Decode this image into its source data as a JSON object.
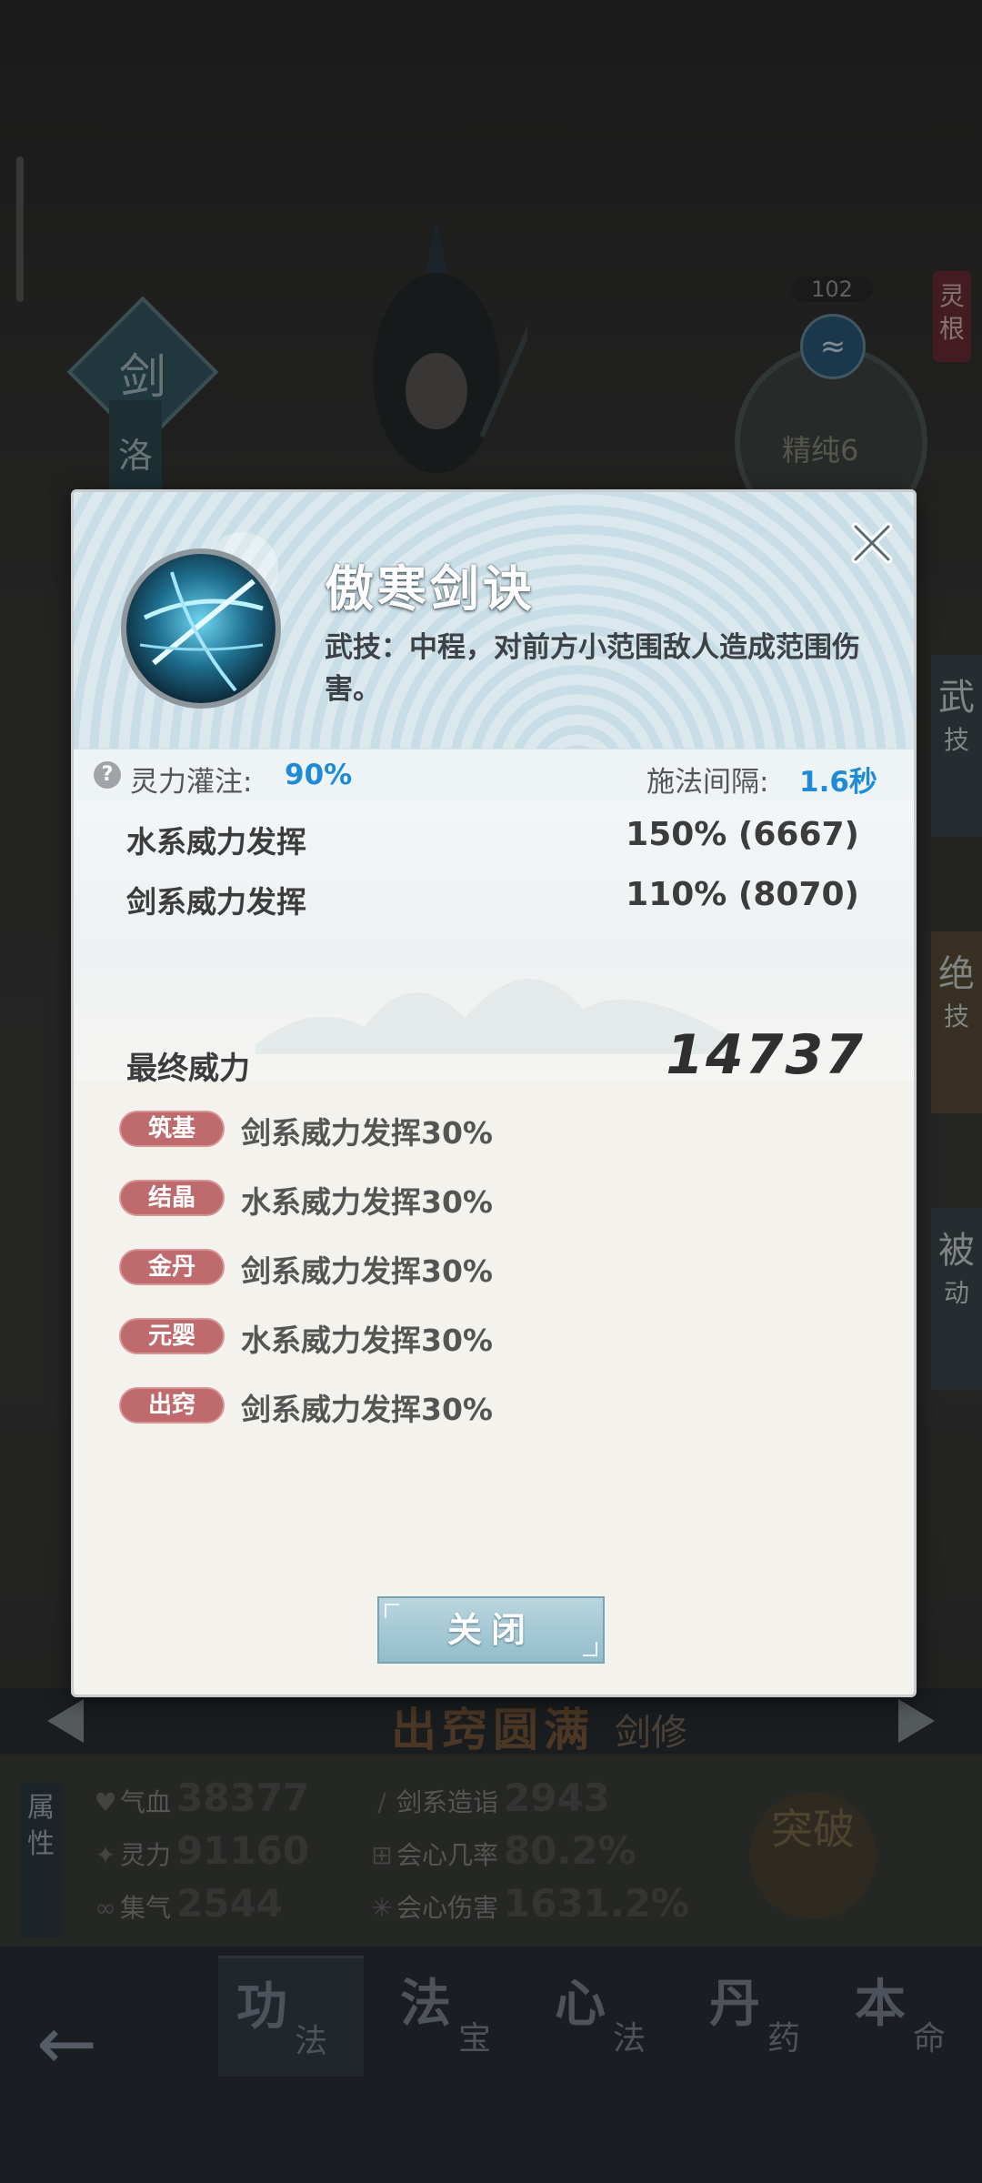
{
  "background": {
    "sword_badge": "剑",
    "name_plate": "洛",
    "lingen_count": "102",
    "lingen_purity": "精纯6",
    "lingen_tag": "灵根",
    "side_tabs": [
      {
        "big": "武",
        "small": "技"
      },
      {
        "big": "绝",
        "small": "技"
      },
      {
        "big": "被",
        "small": "动"
      }
    ],
    "realm_title": "出窍圆满",
    "realm_class": "剑修",
    "attr_tab": "属性",
    "stats": [
      {
        "icon": "heart-icon",
        "label": "气血",
        "value": "38377"
      },
      {
        "icon": "flame-icon",
        "label": "灵力",
        "value": "91160"
      },
      {
        "icon": "swirl-icon",
        "label": "集气",
        "value": "2544"
      },
      {
        "icon": "sword-icon",
        "label": "剑系造诣",
        "value": "2943"
      },
      {
        "icon": "crit-icon",
        "label": "会心几率",
        "value": "80.2%"
      },
      {
        "icon": "spark-icon",
        "label": "会心伤害",
        "value": "1631.2%"
      }
    ],
    "breakthrough": "突破",
    "nav": [
      {
        "big": "功",
        "small": "法"
      },
      {
        "big": "法",
        "small": "宝"
      },
      {
        "big": "心",
        "small": "法"
      },
      {
        "big": "丹",
        "small": "药"
      },
      {
        "big": "本",
        "small": "命"
      }
    ]
  },
  "modal": {
    "title": "傲寒剑诀",
    "description": "武技：中程，对前方小范围敌人造成范围伤害。",
    "infusion_label": "灵力灌注:",
    "infusion_value": "90%",
    "interval_label": "施法间隔:",
    "interval_value": "1.6秒",
    "rows": [
      {
        "label": "水系威力发挥",
        "value": "150% (6667)"
      },
      {
        "label": "剑系威力发挥",
        "value": "110% (8070)"
      }
    ],
    "final_label": "最终威力",
    "final_value": "14737",
    "bonuses": [
      {
        "tag": "筑基",
        "text": "剑系威力发挥30%"
      },
      {
        "tag": "结晶",
        "text": "水系威力发挥30%"
      },
      {
        "tag": "金丹",
        "text": "剑系威力发挥30%"
      },
      {
        "tag": "元婴",
        "text": "水系威力发挥30%"
      },
      {
        "tag": "出窍",
        "text": "剑系威力发挥30%"
      }
    ],
    "close_button": "关闭"
  },
  "colors": {
    "accent_blue": "#1f8bd6",
    "tag_red": "#bf6a6c",
    "button_teal": "#93bccb"
  }
}
